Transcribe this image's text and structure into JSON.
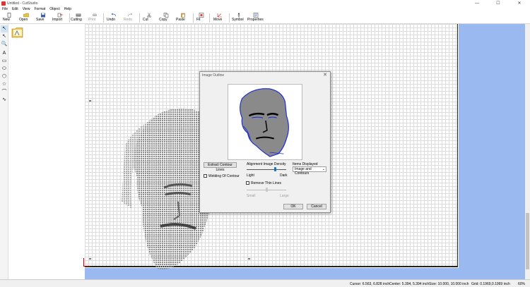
{
  "window": {
    "title": "Untitled - CutStudio",
    "min": "—",
    "max": "☐",
    "close": "✕"
  },
  "menu": [
    "File",
    "Edit",
    "View",
    "Format",
    "Object",
    "Help"
  ],
  "toolbar": {
    "new": "New",
    "open": "Open",
    "save": "Save",
    "import": "Import",
    "cutting": "Cutting",
    "print": "Print",
    "undo": "Undo",
    "redo": "Redo",
    "cut": "Cut",
    "copy": "Copy",
    "paste": "Paste",
    "fit": "Fit",
    "move": "Move",
    "symbol": "Symbol",
    "properties": "Properties"
  },
  "tools": [
    "↖",
    "↖",
    "🔍",
    "A",
    "▭",
    "⬭",
    "⬡",
    "☆",
    "⌒",
    "∿"
  ],
  "status": {
    "cursor": "Cursor: 6.563, 6.828 inch",
    "center": "Center: 5.394, 5.394 inch",
    "size": "Size: 10.000, 10.000 inch",
    "grid": "Grid: 0.1969,0.1969 inch",
    "zoom": "60%"
  },
  "dialog": {
    "title": "Image Outline",
    "close": "✕",
    "extract_button": "Extract Contour Lines",
    "welding_label": "Welding Of Contour",
    "density_label": "Alignment Image Density",
    "light": "Light",
    "dark": "Dark",
    "density": 0.72,
    "remove_thin_label": "Remove Thin Lines",
    "small": "Small",
    "large": "Large",
    "thin": 0.5,
    "items_label": "Items Displayed",
    "items_value": "Image and Contours",
    "ok": "OK",
    "cancel": "Cancel"
  }
}
